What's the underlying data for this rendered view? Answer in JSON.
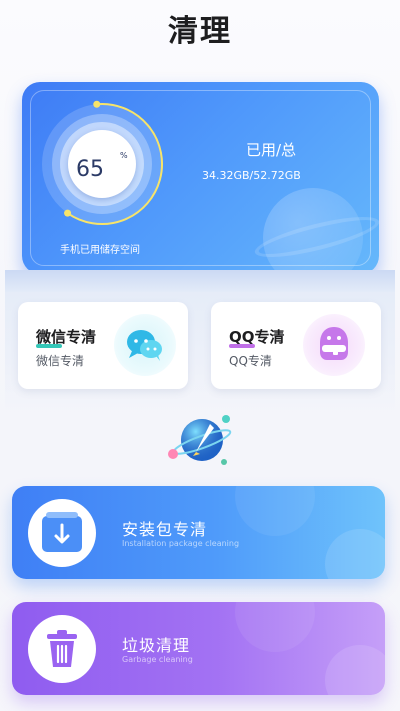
{
  "header": {
    "title": "清理"
  },
  "storage": {
    "percent_value": "65",
    "percent_unit": "%",
    "used_fraction": 0.65,
    "caption": "手机已用储存空间",
    "label": "已用/总",
    "amount": "34.32GB/52.72GB"
  },
  "shortcuts": [
    {
      "title": "微信专清",
      "subtitle": "微信专清",
      "icon": "wechat-icon",
      "accent": "#35c7b8"
    },
    {
      "title": "QQ专清",
      "subtitle": "QQ专清",
      "icon": "qq-icon",
      "accent": "#c06fe8"
    }
  ],
  "features": [
    {
      "title": "安装包专清",
      "subtitle": "Installation package cleaning",
      "icon": "package-download-icon",
      "color": "#4f9bfa"
    },
    {
      "title": "垃圾清理",
      "subtitle": "Garbage cleaning",
      "icon": "trash-can-icon",
      "color": "#a372f3"
    }
  ],
  "colors": {
    "primary_blue": "#3e7bf5",
    "purple": "#8f5cf0",
    "gauge_ring": "#f7e46a"
  }
}
